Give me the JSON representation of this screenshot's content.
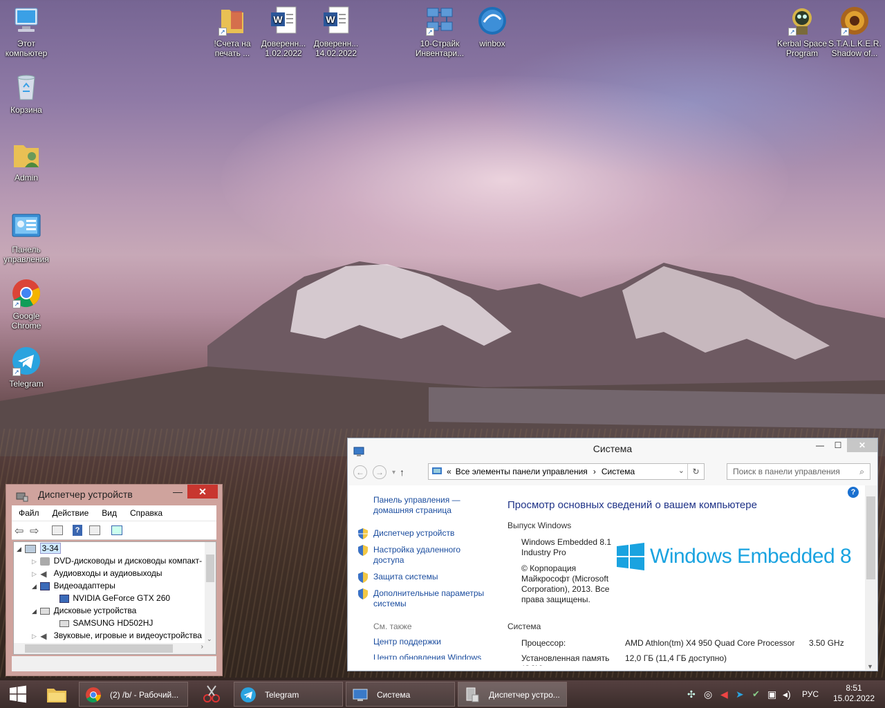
{
  "desktop": {
    "icons_left": [
      {
        "label": "Этот компьютер",
        "icon": "computer-icon"
      },
      {
        "label": "Корзина",
        "icon": "recycle-bin-icon"
      },
      {
        "label": "Admin",
        "icon": "user-folder-icon"
      },
      {
        "label": "Панель управления",
        "icon": "control-panel-icon"
      },
      {
        "label": "Google Chrome",
        "icon": "chrome-icon"
      },
      {
        "label": "Telegram",
        "icon": "telegram-icon"
      }
    ],
    "icons_top": [
      {
        "label": "!Счета на печать ...",
        "icon": "folder-icon"
      },
      {
        "label": "Доверенн... 1.02.2022",
        "icon": "word-doc-icon"
      },
      {
        "label": "Доверенн... 14.02.2022",
        "icon": "word-doc-icon"
      },
      {
        "label": "10-Страйк Инвентари...",
        "icon": "network-inventory-icon"
      },
      {
        "label": "winbox",
        "icon": "winbox-icon"
      },
      {
        "label": "Kerbal Space Program",
        "icon": "kerbal-icon"
      },
      {
        "label": "S.T.A.L.K.E.R. Shadow of...",
        "icon": "stalker-icon"
      }
    ]
  },
  "system_window": {
    "title": "Система",
    "breadcrumb_prefix": "«",
    "breadcrumb_1": "Все элементы панели управления",
    "breadcrumb_sep": "›",
    "breadcrumb_2": "Система",
    "search_placeholder": "Поиск в панели управления",
    "left_links": {
      "home": "Панель управления — домашняя страница",
      "device_manager": "Диспетчер устройств",
      "remote": "Настройка удаленного доступа",
      "protection": "Защита системы",
      "advanced": "Дополнительные параметры системы"
    },
    "see_also_label": "См. также",
    "see_also": [
      "Центр поддержки",
      "Центр обновления Windows"
    ],
    "heading": "Просмотр основных сведений о вашем компьютере",
    "edition_section": "Выпуск Windows",
    "edition_name": "Windows Embedded 8.1 Industry Pro",
    "copyright": "© Корпорация Майкрософт (Microsoft Corporation), 2013. Все права защищены.",
    "logo_text": "Windows Embedded 8",
    "system_section": "Система",
    "processor_label": "Процессор:",
    "processor_value": "AMD Athlon(tm) X4 950 Quad Core Processor",
    "processor_speed": "3.50 GHz",
    "memory_label": "Установленная память (ОЗУ):",
    "memory_value": "12,0 ГБ (11,4 ГБ доступно)",
    "help_glyph": "?"
  },
  "device_manager": {
    "title": "Диспетчер устройств",
    "menu": [
      "Файл",
      "Действие",
      "Вид",
      "Справка"
    ],
    "tree": {
      "root": "3-34",
      "dvd": "DVD-дисководы и дисководы компакт-",
      "audio_io": "Аудиовходы и аудиовыходы",
      "video": "Видеоадаптеры",
      "gpu": "NVIDIA GeForce GTX 260",
      "disks": "Дисковые устройства",
      "hdd": "SAMSUNG HD502HJ",
      "sound": "Звуковые, игровые и видеоустройства"
    }
  },
  "taskbar": {
    "chrome_label": "(2) /b/ - Рабочий...",
    "telegram_label": "Telegram",
    "system_label": "Система",
    "devmgr_label": "Диспетчер устро...",
    "lang": "РУС",
    "time": "8:51",
    "date": "15.02.2022"
  }
}
